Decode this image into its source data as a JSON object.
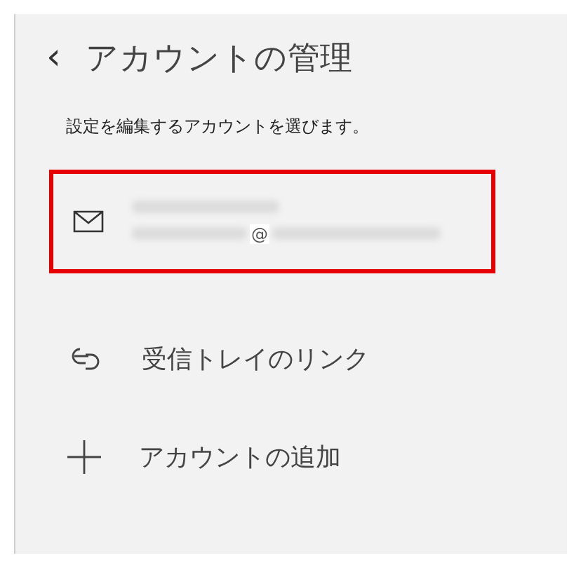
{
  "header": {
    "back": "‹",
    "title": "アカウントの管理"
  },
  "instruction": "設定を編集するアカウントを選びます。",
  "accounts": [
    {
      "email_visible": "@",
      "highlighted": true
    }
  ],
  "actions": [
    {
      "kind": "link",
      "label": "受信トレイのリンク"
    },
    {
      "kind": "add",
      "label": "アカウントの追加"
    }
  ]
}
